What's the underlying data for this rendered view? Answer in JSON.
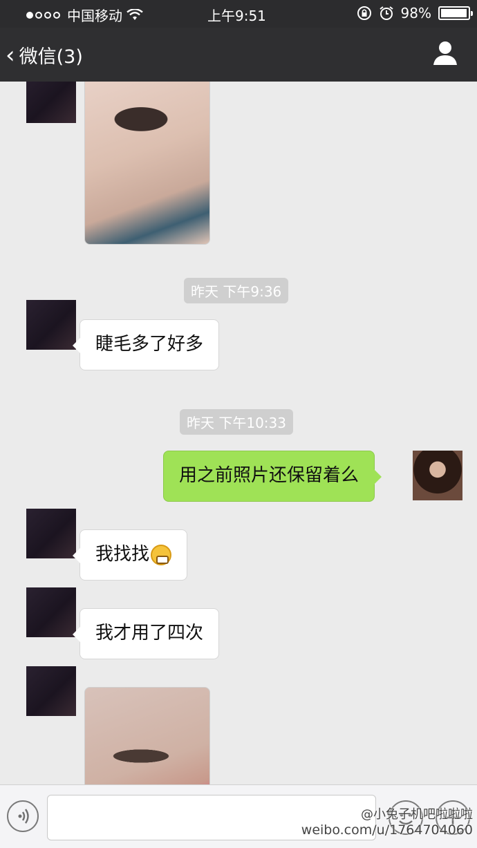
{
  "status_bar": {
    "carrier": "中国移动",
    "time": "上午9:51",
    "battery": "98%",
    "battery_level": 0.98
  },
  "nav": {
    "back_label": "微信(3)",
    "title": ""
  },
  "messages": [
    {
      "kind": "image",
      "side": "in"
    },
    {
      "kind": "time",
      "text": "昨天 下午9:36"
    },
    {
      "kind": "text",
      "side": "in",
      "text": "睫毛多了好多"
    },
    {
      "kind": "time",
      "text": "昨天 下午10:33"
    },
    {
      "kind": "text",
      "side": "out",
      "text": "用之前照片还保留着么"
    },
    {
      "kind": "text",
      "side": "in",
      "text": "我找找",
      "emoji": "grin-icon"
    },
    {
      "kind": "text",
      "side": "in",
      "text": "我才用了四次"
    },
    {
      "kind": "image",
      "side": "in"
    }
  ],
  "watermark": {
    "line1": "@小兔子机吧啦啦啦",
    "line2": "weibo.com/u/1764704060"
  },
  "icons": {
    "wifi": "wifi-icon",
    "orientation_lock": "orientation-lock-icon",
    "alarm": "alarm-icon",
    "profile": "person-icon",
    "voice": "voice-icon",
    "emoji": "emoji-icon",
    "more": "plus-icon"
  },
  "colors": {
    "nav_bg": "#2f2f31",
    "chat_bg": "#ebebeb",
    "outgoing_bubble": "#9fe256",
    "incoming_bubble": "#ffffff"
  }
}
